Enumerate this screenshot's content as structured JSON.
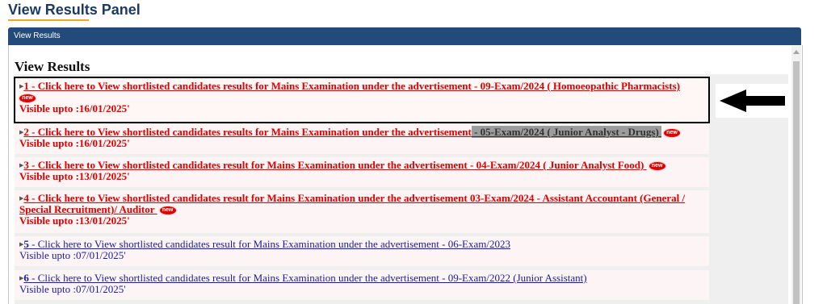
{
  "page": {
    "title": "View Results Panel"
  },
  "panel": {
    "header": "View Results",
    "heading": "View Results"
  },
  "new_badge": "new",
  "items": [
    {
      "num": "1",
      "text": " - Click here to View shortlisted candidates results for Mains Examination under the advertisement - 09-Exam/2024 ( Homoeopathic Pharmacists)",
      "visible": "Visible upto :16/01/2025'",
      "is_new": true,
      "color": "red"
    },
    {
      "num": "2",
      "text": " - Click here to View shortlisted candidates results for Mains Examination under the advertisement",
      "text_highlight": " - 05-Exam/2024 ( Junior Analyst - Drugs) ",
      "visible": "Visible upto :16/01/2025'",
      "is_new": true,
      "color": "red"
    },
    {
      "num": "3",
      "text": " - Click here to View shortlisted candidates result for Mains Examination under the advertisement - 04-Exam/2024 ( Junior Analyst Food) ",
      "visible": "Visible upto :13/01/2025'",
      "is_new": true,
      "color": "red"
    },
    {
      "num": "4",
      "text": " - Click here to View shortlisted candidates result for Mains Examination under the advertisement 03-Exam/2024 - Assistant Accountant (General / Special Recruitment)/ Auditor ",
      "visible": "Visible upto :13/01/2025'",
      "is_new": true,
      "color": "red"
    },
    {
      "num": "5",
      "text": " - Click here to View shortlisted candidates result for Mains Examination under the advertisement - 06-Exam/2023",
      "visible": "Visible upto :07/01/2025'",
      "is_new": false,
      "color": "blue"
    },
    {
      "num": "6",
      "text": " - Click here to View shortlisted candidates result for Mains Examination under the advertisement - 09-Exam/2022 (Junior Assistant)",
      "visible": "Visible upto :07/01/2025'",
      "is_new": false,
      "color": "blue"
    }
  ],
  "colors": {
    "header_bg": "#224a7a",
    "new_item": "#e00000",
    "old_item": "#1a1aa6",
    "accent": "#f0a81c"
  },
  "annotation": {
    "icon": "left-arrow-icon"
  }
}
